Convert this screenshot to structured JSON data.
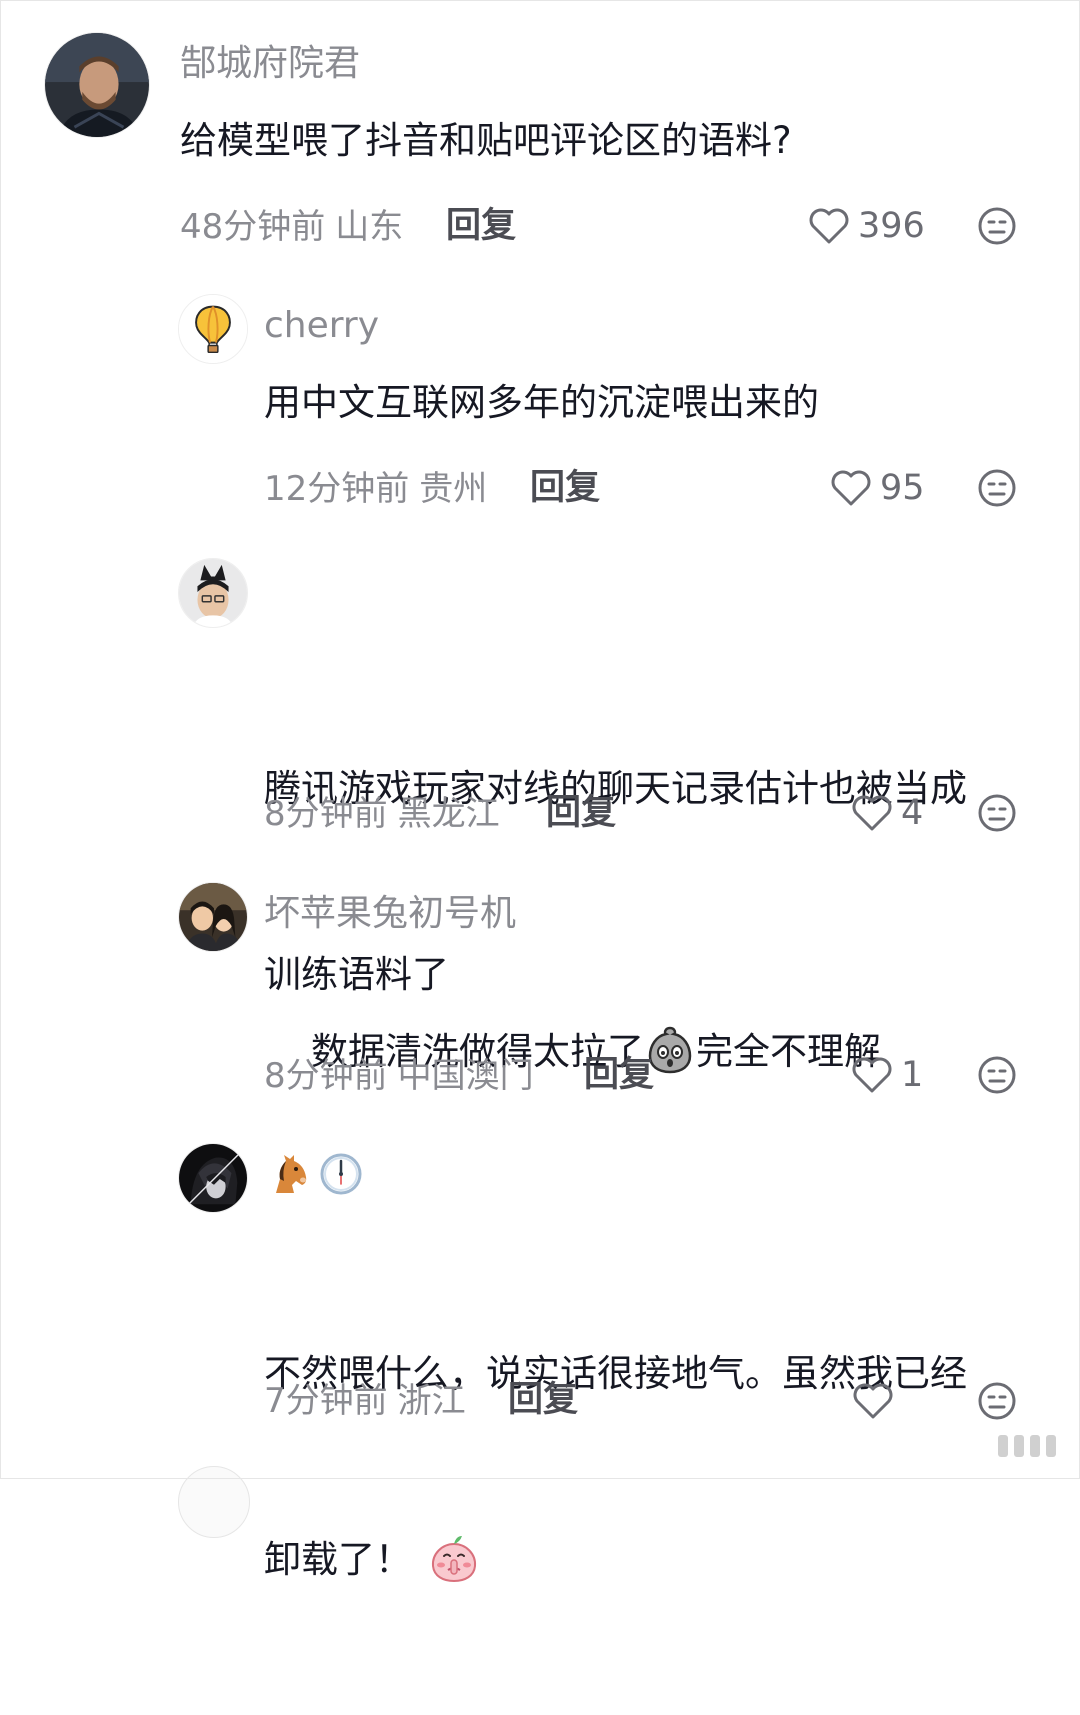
{
  "comments": [
    {
      "username": "郜城府院君",
      "text": "给模型喂了抖音和贴吧评论区的语料?",
      "time": "48分钟前",
      "location": "山东",
      "reply_label": "回复",
      "likes": "396",
      "avatar_icon": "man-portrait-avatar"
    },
    {
      "username": "cherry",
      "text": "用中文互联网多年的沉淀喂出来的",
      "time": "12分钟前",
      "location": "贵州",
      "reply_label": "回复",
      "likes": "95",
      "avatar_icon": "hot-air-balloon-avatar"
    },
    {
      "username": "",
      "text_line1": "腾讯游戏玩家对线的聊天记录估计也被当成",
      "text_line2": "训练语料了",
      "time": "8分钟前",
      "location": "黑龙江",
      "reply_label": "回复",
      "likes": "4",
      "avatar_icon": "man-with-cat-ears-avatar"
    },
    {
      "username": "坏苹果兔初号机",
      "text_before_emoji": "数据清洗做得太拉了",
      "text_after_emoji": "完全不理解",
      "emoji": "shocked-ghost-emoji",
      "time": "8分钟前",
      "location": "中国澳门",
      "reply_label": "回复",
      "likes": "1",
      "avatar_icon": "couple-illustration-avatar"
    },
    {
      "username_emojis": [
        "horse-emoji",
        "clock-emoji"
      ],
      "text_line1": "不然喂什么，说实话很接地气。虽然我已经",
      "text_line2": "卸载了！",
      "emoji": "shushing-peach-emoji",
      "time": "7分钟前",
      "location": "浙江",
      "reply_label": "回复",
      "likes": "",
      "avatar_icon": "dark-anime-avatar"
    }
  ],
  "icons": {
    "like": "heart-outline-icon",
    "dislike": "meh-face-icon"
  },
  "colors": {
    "text": "#161823",
    "secondary": "#8a8b91",
    "reply": "#4b4c53"
  }
}
